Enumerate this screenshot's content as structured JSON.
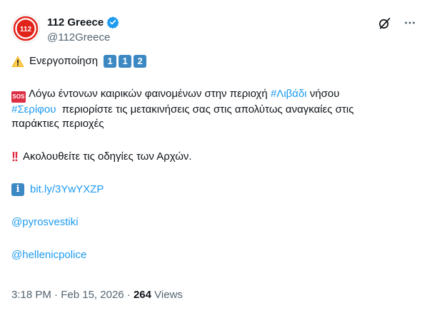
{
  "author": {
    "display_name": "112 Greece",
    "handle": "@112Greece",
    "avatar_text": "112",
    "verified": true
  },
  "colors": {
    "accent": "#1d9bf0",
    "avatar_red": "#e2231a",
    "keycap_blue": "#3b88c3",
    "sos_red": "#dd2e44"
  },
  "icons": {
    "verified": "verified-badge-icon",
    "grok": "slash-circle-icon",
    "more": "more-icon",
    "warning": "warning-icon",
    "sos": "sos-icon",
    "double_bang": "double-exclamation-icon",
    "info": "info-icon"
  },
  "tweet": {
    "line1_text": "Ενεργοποίηση",
    "keycaps": [
      "1",
      "1",
      "2"
    ],
    "sos_label": "SOS",
    "p2_text1": "Λόγω έντονων καιρικών φαινομένων στην περιοχή",
    "hashtag1": "#Λιβάδι",
    "p2_text2": "νήσου",
    "hashtag2": "#Σερίφου",
    "p2_text3": "περιορίστε τις μετακινήσεις σας στις απολύτως αναγκαίες στις",
    "p2_text4": "παράκτιες περιοχές",
    "bang_glyph": "!!",
    "p3_text": "Ακολουθείτε τις οδηγίες των Αρχών.",
    "info_glyph": "i",
    "link": "bit.ly/3YwYXZP",
    "mention1": "@pyrosvestiki",
    "mention2": "@hellenicpolice"
  },
  "meta": {
    "time": "3:18 PM",
    "separator": "·",
    "date": "Feb 15, 2026",
    "views_count": "264",
    "views_label": "Views"
  }
}
